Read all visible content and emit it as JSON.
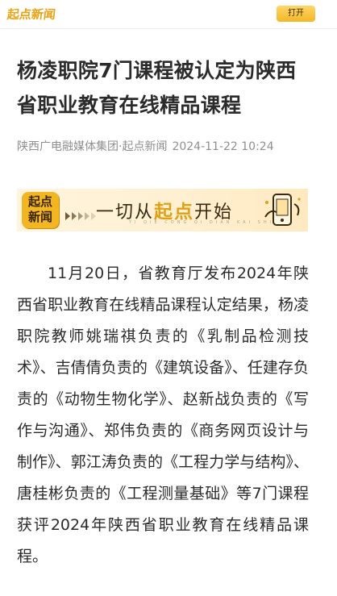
{
  "topbar": {
    "brand_text": "起点新闻",
    "open_label": "打开"
  },
  "article": {
    "title": "杨凌职院7门课程被认定为陕西省职业教育在线精品课程",
    "source": "陕西广电融媒体集团·起点新闻",
    "datetime": "2024-11-22 10:24",
    "body": "11月20日，省教育厅发布2024年陕西省职业教育在线精品课程认定结果，杨凌职院教师姚瑞祺负责的《乳制品检测技术》、吉倩倩负责的《建筑设备》、任建存负责的《动物生物化学》、赵新战负责的《写作与沟通》、郑伟负责的《商务网页设计与制作》、郭江涛负责的《工程力学与结构》、唐桂彬负责的《工程测量基础》等7门课程获评2024年陕西省职业教育在线精品课程。"
  },
  "banner": {
    "logo_text": "起点\n新闻",
    "slogan_pre": "一切从",
    "slogan_highlight": "起点",
    "slogan_post": "开始",
    "pinyin": "YI QIE CONG QI DIAN KAI SHI"
  },
  "colors": {
    "brand": "#e8a318",
    "open_button": "#f3b727",
    "title": "#2b2b2b",
    "meta": "#8f8f8f"
  },
  "icons": {
    "play": "play-arrows-icon",
    "phone": "phone-icon"
  }
}
